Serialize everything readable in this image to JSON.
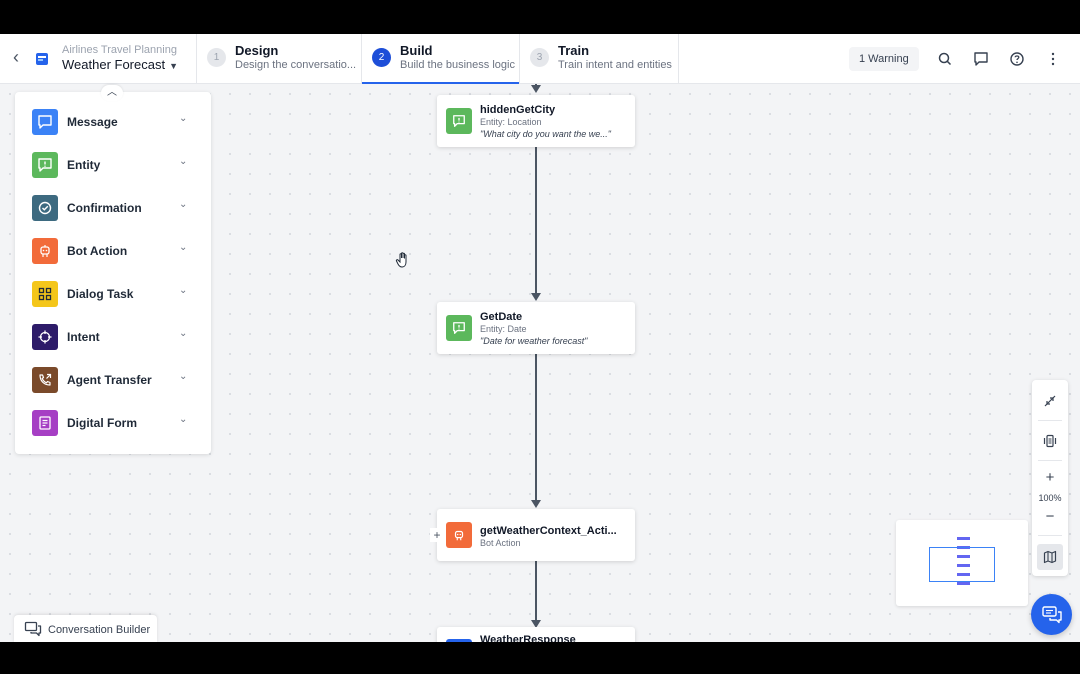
{
  "header": {
    "back_label": "‹",
    "app_subtitle": "Airlines Travel Planning",
    "app_title": "Weather Forecast",
    "steps": [
      {
        "number": "1",
        "title": "Design",
        "subtitle": "Design the conversatio..."
      },
      {
        "number": "2",
        "title": "Build",
        "subtitle": "Build the business logic"
      },
      {
        "number": "3",
        "title": "Train",
        "subtitle": "Train intent and entities"
      }
    ],
    "warning_label": "1 Warning"
  },
  "palette": {
    "items": [
      {
        "label": "Message",
        "icon": "message-icon",
        "color": "#3b82f6"
      },
      {
        "label": "Entity",
        "icon": "entity-icon",
        "color": "#5cb85c"
      },
      {
        "label": "Confirmation",
        "icon": "confirmation-icon",
        "color": "#3d6a80"
      },
      {
        "label": "Bot Action",
        "icon": "bot-action-icon",
        "color": "#f26b3a"
      },
      {
        "label": "Dialog Task",
        "icon": "dialog-task-icon",
        "color": "#f4c61a"
      },
      {
        "label": "Intent",
        "icon": "intent-icon",
        "color": "#2d1b69"
      },
      {
        "label": "Agent Transfer",
        "icon": "agent-transfer-icon",
        "color": "#7a4a2a"
      },
      {
        "label": "Digital Form",
        "icon": "digital-form-icon",
        "color": "#a63fc4"
      }
    ]
  },
  "flow": {
    "nodes": [
      {
        "title": "hiddenGetCity",
        "type": "Entity: Location",
        "prompt": "\"What city do you want the we...\"",
        "color": "#5cb85c"
      },
      {
        "title": "GetDate",
        "type": "Entity: Date",
        "prompt": "\"Date for weather forecast\"",
        "color": "#5cb85c"
      },
      {
        "title": "getWeatherContext_Acti...",
        "type": "Bot Action",
        "prompt": "",
        "color": "#f26b3a"
      },
      {
        "title": "WeatherResponse",
        "type": "",
        "prompt": "",
        "color": "#2563eb"
      }
    ],
    "add_label": "+"
  },
  "zoom": {
    "level": "100%",
    "zoom_in_label": "+",
    "zoom_out_label": "−"
  },
  "footer": {
    "conversation_builder_label": "Conversation Builder"
  },
  "colors": {
    "accent": "#2563eb"
  }
}
